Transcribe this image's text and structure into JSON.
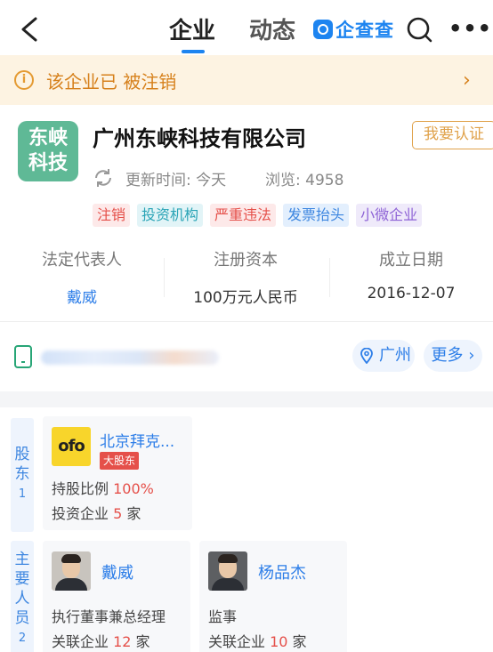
{
  "nav": {
    "tab_company": "企业",
    "tab_news": "动态",
    "brand": "企查查",
    "more": "•••"
  },
  "notice": {
    "text": "该企业已 被注销",
    "chevron": "›"
  },
  "company": {
    "logo_line1": "东峡",
    "logo_line2": "科技",
    "name": "广州东峡科技有限公司",
    "claim_label": "我要认证",
    "updated": "更新时间: 今天",
    "views": "浏览: 4958",
    "tags": [
      "注销",
      "投资机构",
      "严重违法",
      "发票抬头",
      "小微企业"
    ]
  },
  "stats": {
    "legal_rep_label": "法定代表人",
    "legal_rep_value": "戴威",
    "capital_label": "注册资本",
    "capital_value": "100万元人民币",
    "date_label": "成立日期",
    "date_value": "2016-12-07"
  },
  "contact": {
    "location": "广州",
    "more_label": "更多"
  },
  "shareholders": {
    "side_chars": [
      "股",
      "东"
    ],
    "count": "1",
    "logo_text": "ofo",
    "name": "北京拜克...",
    "badge": "大股东",
    "ratio_label": "持股比例 ",
    "ratio_value": "100%",
    "invest_label": "投资企业 ",
    "invest_value": "5",
    "invest_unit": " 家"
  },
  "staff": {
    "side_chars": [
      "主",
      "要",
      "人",
      "员"
    ],
    "count": "2",
    "people": [
      {
        "name": "戴威",
        "role": "执行董事兼总经理",
        "related_label": "关联企业 ",
        "related_value": "12",
        "related_unit": " 家"
      },
      {
        "name": "杨品杰",
        "role": "监事",
        "related_label": "关联企业 ",
        "related_value": "10",
        "related_unit": " 家"
      }
    ]
  },
  "colors": {
    "accent": "#1d84f0",
    "warning": "#d6801b",
    "danger": "#e5504a",
    "link": "#2d7ee8",
    "logo_bg": "#5fb996"
  },
  "icons": [
    "back-icon",
    "search-icon",
    "more-icon",
    "info-icon",
    "refresh-icon",
    "phone-icon",
    "location-pin-icon",
    "chevron-right-icon"
  ]
}
